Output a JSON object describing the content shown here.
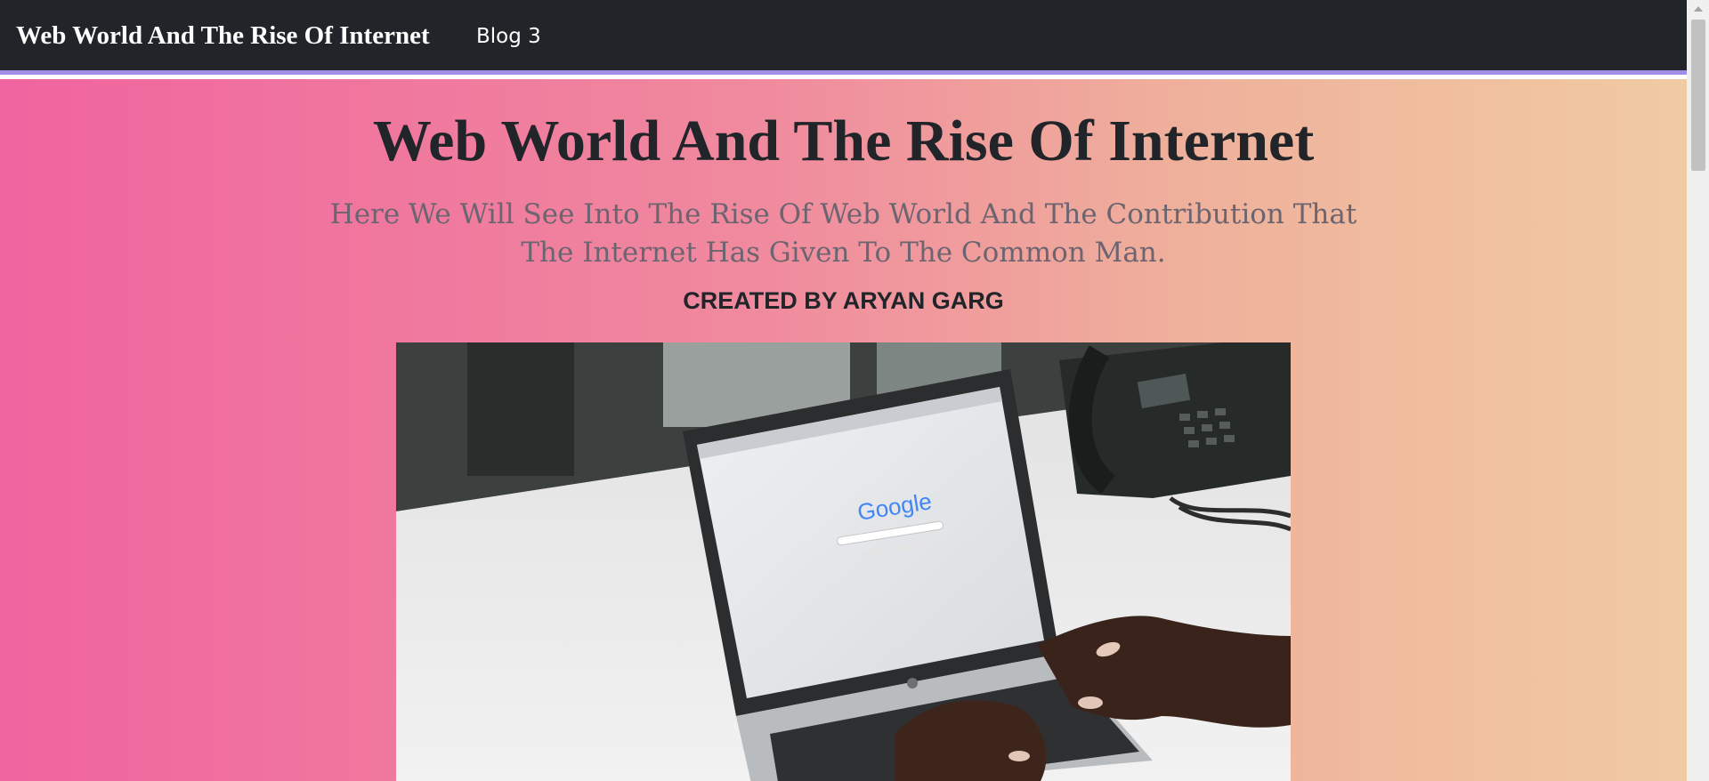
{
  "navbar": {
    "brand": "Web World And The Rise Of Internet",
    "links": [
      "Blog 3"
    ]
  },
  "header": {
    "title": "Web World And The Rise Of Internet",
    "subtitle": "Here We Will See Into The Rise Of Web World And The Contribution That The Internet Has Given To The Common Man.",
    "author": "CREATED BY ARYAN GARG"
  },
  "colors": {
    "navbar_bg": "#212529",
    "navbar_border": "#a08ee6",
    "gradient_start": "#f0649f",
    "gradient_end": "#f0cba3"
  },
  "hero_image": {
    "screen_logo": "Google"
  },
  "icons": [
    "scroll-up-arrow-icon"
  ]
}
